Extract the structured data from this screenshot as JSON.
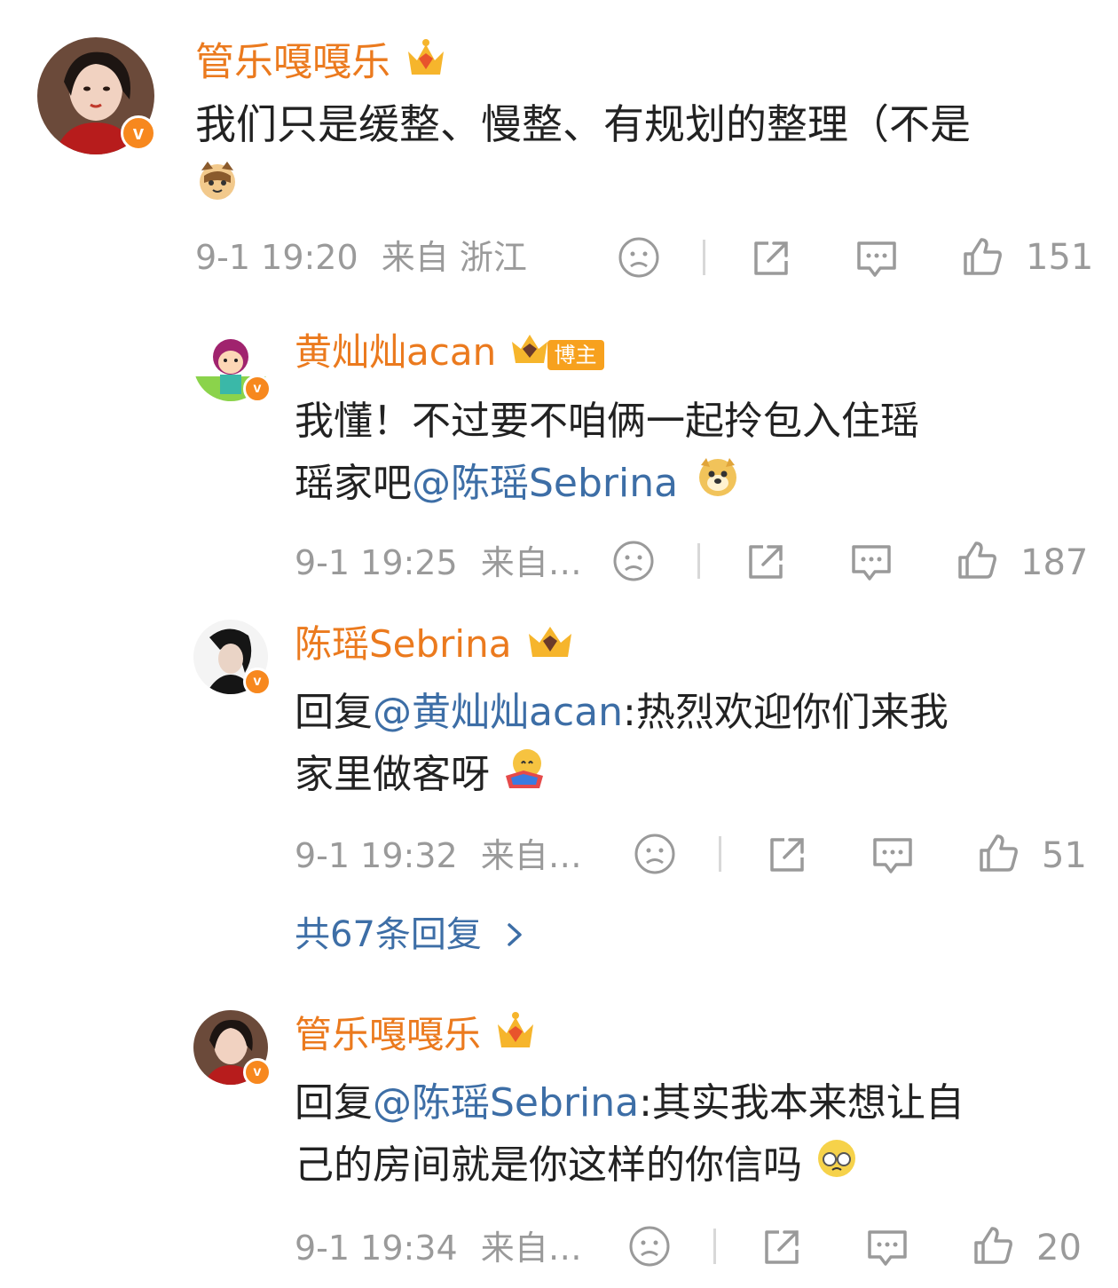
{
  "comments": [
    {
      "username": "管乐嘎嘎乐",
      "text": "我们只是缓整、慢整、有规划的整理（不是",
      "time": "9-1 19:20",
      "source": "来自 浙江",
      "likes": "151"
    },
    {
      "username": "黄灿灿acan",
      "badge": "博主",
      "text_line1": "我懂！不过要不咱俩一起拎包入住瑶",
      "text_line2_prefix": "瑶家吧",
      "mention": "@陈瑶Sebrina",
      "time": "9-1 19:25",
      "source": "来自…",
      "likes": "187"
    },
    {
      "username": "陈瑶Sebrina",
      "reply_prefix": "回复",
      "mention": "@黄灿灿acan",
      "text_line1_suffix": ":热烈欢迎你们来我",
      "text_line2": "家里做客呀",
      "time": "9-1 19:32",
      "source": "来自…",
      "likes": "51"
    },
    {
      "username": "管乐嘎嘎乐",
      "reply_prefix": "回复",
      "mention": "@陈瑶Sebrina",
      "text_line1_suffix": ":其实我本来想让自",
      "text_line2": "己的房间就是你这样的你信吗",
      "time": "9-1 19:34",
      "source": "来自…",
      "likes": "20"
    }
  ],
  "more_replies": "共67条回复",
  "colors": {
    "username": "#eb7a1e",
    "mention": "#3d6ea6",
    "meta": "#9a9a9a",
    "badge": "#f7881e"
  }
}
